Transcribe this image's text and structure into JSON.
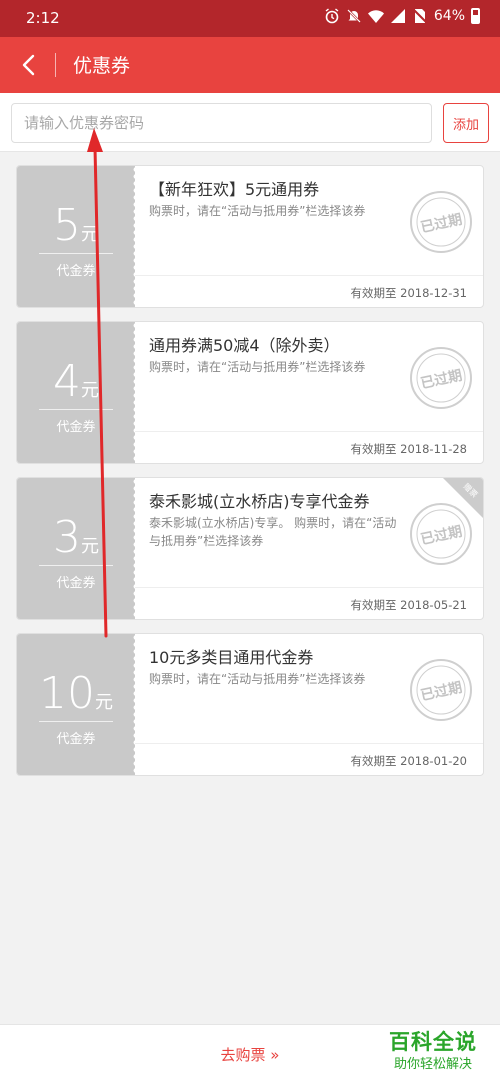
{
  "status_bar": {
    "time": "2:12",
    "battery": "64%"
  },
  "header": {
    "title": "优惠券"
  },
  "search": {
    "placeholder": "请输入优惠券密码",
    "value": "",
    "add_label": "添加"
  },
  "coupons": [
    {
      "amount": "5",
      "unit": "元",
      "type": "代金券",
      "title": "【新年狂欢】5元通用券",
      "desc": "购票时，请在“活动与抵用券”栏选择该券",
      "validity": "有效期至 2018-12-31",
      "stamp": "已过期"
    },
    {
      "amount": "4",
      "unit": "元",
      "type": "代金券",
      "title": "通用券满50减4（除外卖）",
      "desc": "购票时，请在“活动与抵用券”栏选择该券",
      "validity": "有效期至 2018-11-28",
      "stamp": "已过期"
    },
    {
      "amount": "3",
      "unit": "元",
      "type": "代金券",
      "title": "泰禾影城(立水桥店)专享代金券",
      "desc": "泰禾影城(立水桥店)专享。 购票时，请在“活动与抵用券”栏选择该券",
      "validity": "有效期至 2018-05-21",
      "stamp": "已过期",
      "corner_label": "赠票"
    },
    {
      "amount": "10",
      "unit": "元",
      "type": "代金券",
      "title": "10元多类目通用代金券",
      "desc": "购票时，请在“活动与抵用券”栏选择该券",
      "validity": "有效期至 2018-01-20",
      "stamp": "已过期"
    }
  ],
  "footer": {
    "buy_label": "去购票",
    "buy_icon": "double-chevron-right-icon"
  },
  "watermark": {
    "title": "百科全说",
    "subtitle": "助你轻松解决"
  },
  "colors": {
    "status_bar": "#b3262b",
    "app_bar": "#e8433f",
    "accent": "#e8433f",
    "coupon_left": "#c9c9c9",
    "watermark": "#2aa52a",
    "arrow": "#e0282a"
  }
}
